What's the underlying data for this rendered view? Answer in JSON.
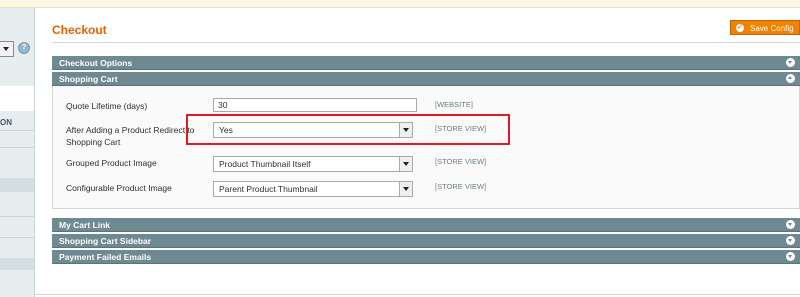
{
  "page": {
    "title": "Checkout"
  },
  "toolbar": {
    "save_label": "Save Config"
  },
  "sidebar": {
    "section_label": "ON",
    "help_glyph": "?"
  },
  "sections": {
    "checkout_options": "Checkout Options",
    "shopping_cart": "Shopping Cart",
    "my_cart_link": "My Cart Link",
    "shopping_cart_sidebar": "Shopping Cart Sidebar",
    "payment_failed_emails": "Payment Failed Emails"
  },
  "fields": {
    "quote_lifetime": {
      "label": "Quote Lifetime (days)",
      "value": "30",
      "scope": "[WEBSITE]"
    },
    "redirect_to_cart": {
      "label": "After Adding a Product Redirect to Shopping Cart",
      "value": "Yes",
      "scope": "[STORE VIEW]"
    },
    "grouped_image": {
      "label": "Grouped Product Image",
      "value": "Product Thumbnail Itself",
      "scope": "[STORE VIEW]"
    },
    "configurable_image": {
      "label": "Configurable Product Image",
      "value": "Parent Product Thumbnail",
      "scope": "[STORE VIEW]"
    }
  },
  "icons": {
    "save": "check-circle-icon",
    "collapse": "chevron-up-icon",
    "expand": "chevron-down-icon",
    "help": "help-icon"
  }
}
